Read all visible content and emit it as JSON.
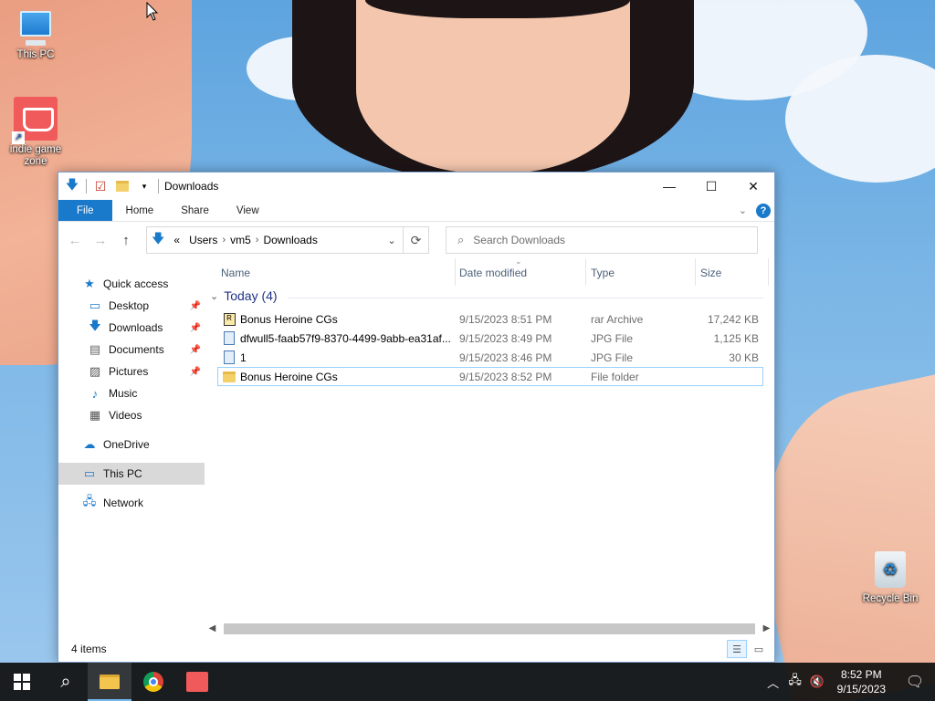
{
  "desktop": {
    "icons": [
      {
        "label": "This PC",
        "icon": "computer-icon"
      },
      {
        "label": "indie game zone",
        "icon": "indie-game-zone-icon"
      },
      {
        "label": "Recycle Bin",
        "icon": "recycle-bin-icon"
      }
    ]
  },
  "window": {
    "title": "Downloads",
    "controls": {
      "minimize": "—",
      "maximize": "☐",
      "close": "✕"
    },
    "ribbon": {
      "tabs": [
        "File",
        "Home",
        "Share",
        "View"
      ]
    },
    "address": {
      "overflow": "«",
      "segments": [
        "Users",
        "vm5",
        "Downloads"
      ]
    },
    "search": {
      "placeholder": "Search Downloads"
    },
    "nav_pane": {
      "quick_access": "Quick access",
      "pinned": [
        "Desktop",
        "Downloads",
        "Documents",
        "Pictures"
      ],
      "unpinned": [
        "Music",
        "Videos"
      ],
      "onedrive": "OneDrive",
      "this_pc": "This PC",
      "network": "Network"
    },
    "columns": [
      "Name",
      "Date modified",
      "Type",
      "Size"
    ],
    "group": {
      "label": "Today (4)"
    },
    "files": [
      {
        "name": "Bonus Heroine CGs",
        "date": "9/15/2023 8:51 PM",
        "type": "rar Archive",
        "size": "17,242 KB",
        "icon": "rar-archive-icon"
      },
      {
        "name": "dfwull5-faab57f9-8370-4499-9abb-ea31af...",
        "date": "9/15/2023 8:49 PM",
        "type": "JPG File",
        "size": "1,125 KB",
        "icon": "jpg-file-icon"
      },
      {
        "name": "1",
        "date": "9/15/2023 8:46 PM",
        "type": "JPG File",
        "size": "30 KB",
        "icon": "jpg-file-icon"
      },
      {
        "name": "Bonus Heroine CGs",
        "date": "9/15/2023 8:52 PM",
        "type": "File folder",
        "size": "",
        "icon": "folder-icon"
      }
    ],
    "status": {
      "item_count": "4 items"
    }
  },
  "taskbar": {
    "clock": {
      "time": "8:52 PM",
      "date": "9/15/2023"
    }
  },
  "colors": {
    "accent": "#1979ca",
    "taskbar": "#101010",
    "group_header": "#1e3287"
  }
}
